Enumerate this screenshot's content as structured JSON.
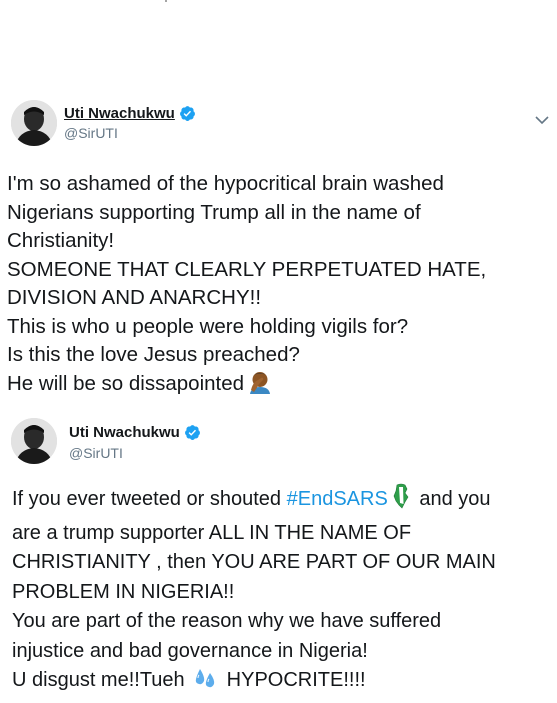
{
  "tweets": [
    {
      "display_name": "Uti Nwachukwu",
      "handle": "@SirUTI",
      "lines": [
        "I'm so ashamed of the hypocritical brain washed",
        "Nigerians supporting Trump all in the name of",
        "Christianity!",
        "SOMEONE THAT CLEARLY PERPETUATED HATE,",
        "DIVISION AND ANARCHY!!",
        "This is who u people were holding vigils for?",
        "Is this the love Jesus preached?",
        "He will be so dissapointed"
      ],
      "end_emoji": "facepalm-emoji"
    },
    {
      "display_name": "Uti Nwachukwu",
      "handle": "@SirUTI",
      "line1_prefix": "If you ever tweeted or shouted ",
      "hashtag": "#EndSARS",
      "line1_suffix": " and you",
      "lines": [
        "are a trump supporter ALL IN THE NAME OF",
        "CHRISTIANITY , then YOU ARE PART OF OUR MAIN",
        "PROBLEM IN NIGERIA!!",
        "You are part of the reason why we have suffered",
        "injustice and bad governance in Nigeria!"
      ],
      "last_prefix": "U disgust me!!Tueh",
      "last_suffix": "HYPOCRITE!!!!",
      "emojis": [
        "nigeria-map-emoji",
        "sweat-droplets-emoji"
      ]
    }
  ],
  "colors": {
    "text": "#14171a",
    "secondary": "#657786",
    "link": "#1b95e0",
    "verified": "#1da1f2"
  }
}
